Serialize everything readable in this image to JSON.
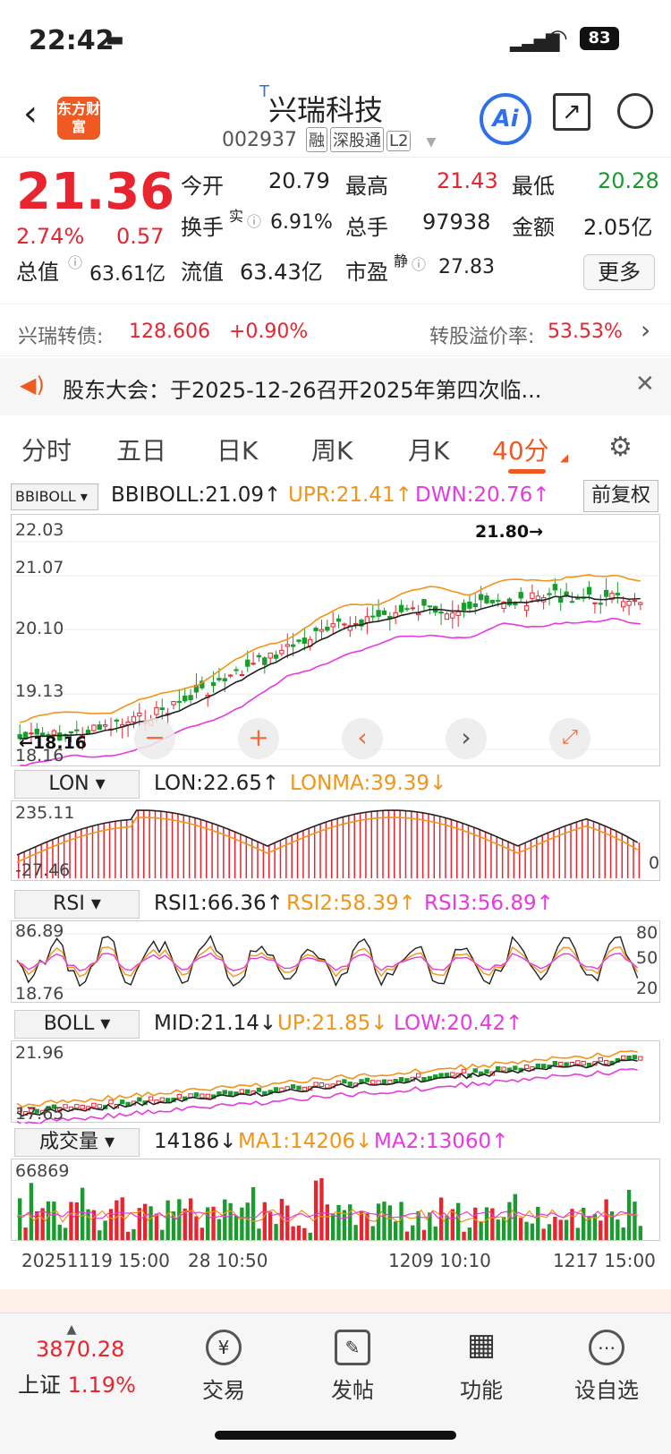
{
  "status": {
    "time": "22:42",
    "battery": "83"
  },
  "header": {
    "name": "兴瑞科技",
    "code": "002937",
    "tags": [
      "融",
      "深股通",
      "L2"
    ],
    "logo": "东方财富",
    "ai": "Ai"
  },
  "quote": {
    "price": "21.36",
    "change_pct": "2.74%",
    "change": "0.57",
    "open_label": "今开",
    "open": "20.79",
    "high_label": "最高",
    "high": "21.43",
    "low_label": "最低",
    "low": "20.28",
    "turnover_label": "换手",
    "turnover_sup": "实",
    "turnover": "6.91%",
    "volume_label": "总手",
    "volume": "97938",
    "amount_label": "金额",
    "amount": "2.05亿",
    "mktcap_label": "总值",
    "mktcap": "63.61亿",
    "float_label": "流值",
    "float": "63.43亿",
    "pe_label": "市盈",
    "pe_sup": "静",
    "pe": "27.83",
    "more": "更多"
  },
  "bond": {
    "label": "兴瑞转债:",
    "price": "128.606",
    "chg": "+0.90%",
    "premium_label": "转股溢价率:",
    "premium": "53.53%"
  },
  "notice": {
    "text": "股东大会：于2025-12-26召开2025年第四次临..."
  },
  "tabs": [
    "分时",
    "五日",
    "日K",
    "周K",
    "月K",
    "40分"
  ],
  "active_tab": "40分",
  "main_ind": {
    "sel": "BBIBOLL",
    "v1": "BBIBOLL:21.09↑",
    "v2": "UPR:21.41↑",
    "v3": "DWN:20.76↑",
    "adj": "前复权",
    "ticks": [
      "22.03",
      "21.07",
      "20.10",
      "19.13",
      "18.16"
    ],
    "hi_label": "21.80",
    "lo_label": "18.16"
  },
  "lon": {
    "sel": "LON",
    "v1": "LON:22.65↑",
    "v2": "LONMA:39.39↓",
    "top": "235.11",
    "bottom": "-27.46",
    "right": "0"
  },
  "rsi": {
    "sel": "RSI",
    "v1": "RSI1:66.36↑",
    "v2": "RSI2:58.39↑",
    "v3": "RSI3:56.89↑",
    "top": "86.89",
    "bottom": "18.76",
    "r80": "80",
    "r50": "50",
    "r20": "20"
  },
  "boll": {
    "sel": "BOLL",
    "v1": "MID:21.14↓",
    "v2": "UP:21.85↓",
    "v3": "LOW:20.42↑",
    "top": "21.96",
    "bottom": "17.65"
  },
  "vol": {
    "sel": "成交量",
    "v1": "14186↓",
    "v2": "MA1:14206↓",
    "v3": "MA2:13060↑",
    "top": "66869"
  },
  "dates": [
    "20251119 15:00",
    "28 10:50",
    "1209 10:10",
    "1217 15:00"
  ],
  "index": {
    "value": "3870.28",
    "name": "上证",
    "pct": "1.19%"
  },
  "tabbar": [
    {
      "label": "交易",
      "icon": "¥"
    },
    {
      "label": "发帖",
      "icon": "✎"
    },
    {
      "label": "功能",
      "icon": "▦"
    },
    {
      "label": "设自选",
      "icon": "⋯"
    }
  ]
}
